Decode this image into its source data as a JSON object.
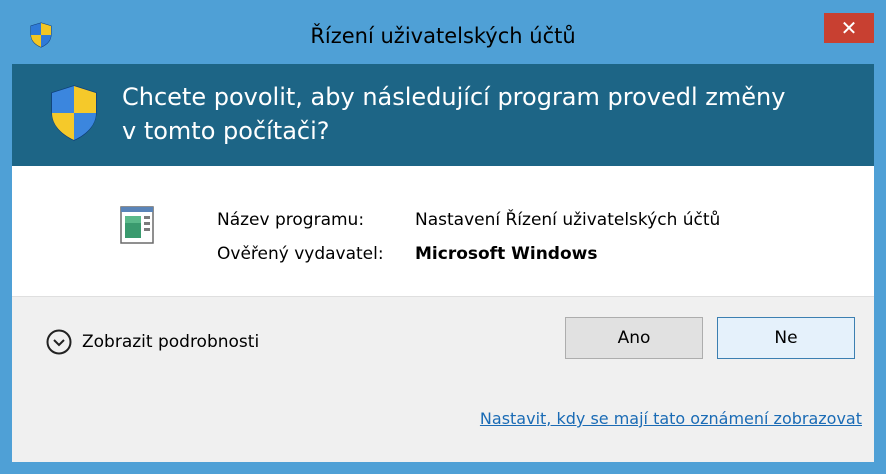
{
  "window": {
    "title": "Řízení uživatelských účtů",
    "close_label": "✕",
    "accent_color": "#4fa0d6",
    "banner_color": "#1d6586"
  },
  "banner": {
    "question_line1": "Chcete povolit, aby následující program provedl změny",
    "question_line2": "v tomto počítači?",
    "icon": "uac-shield-icon"
  },
  "program_info": {
    "name_label": "Název programu:",
    "name_value": "Nastavení Řízení uživatelských účtů",
    "publisher_label": "Ověřený vydavatel:",
    "publisher_value": "Microsoft Windows",
    "icon": "program-window-icon"
  },
  "footer": {
    "details_label": "Zobrazit podrobnosti",
    "details_icon": "chevron-down-circle-icon",
    "yes_label": "Ano",
    "no_label": "Ne",
    "settings_link": "Nastavit, kdy se mají tato oznámení zobrazovat"
  }
}
